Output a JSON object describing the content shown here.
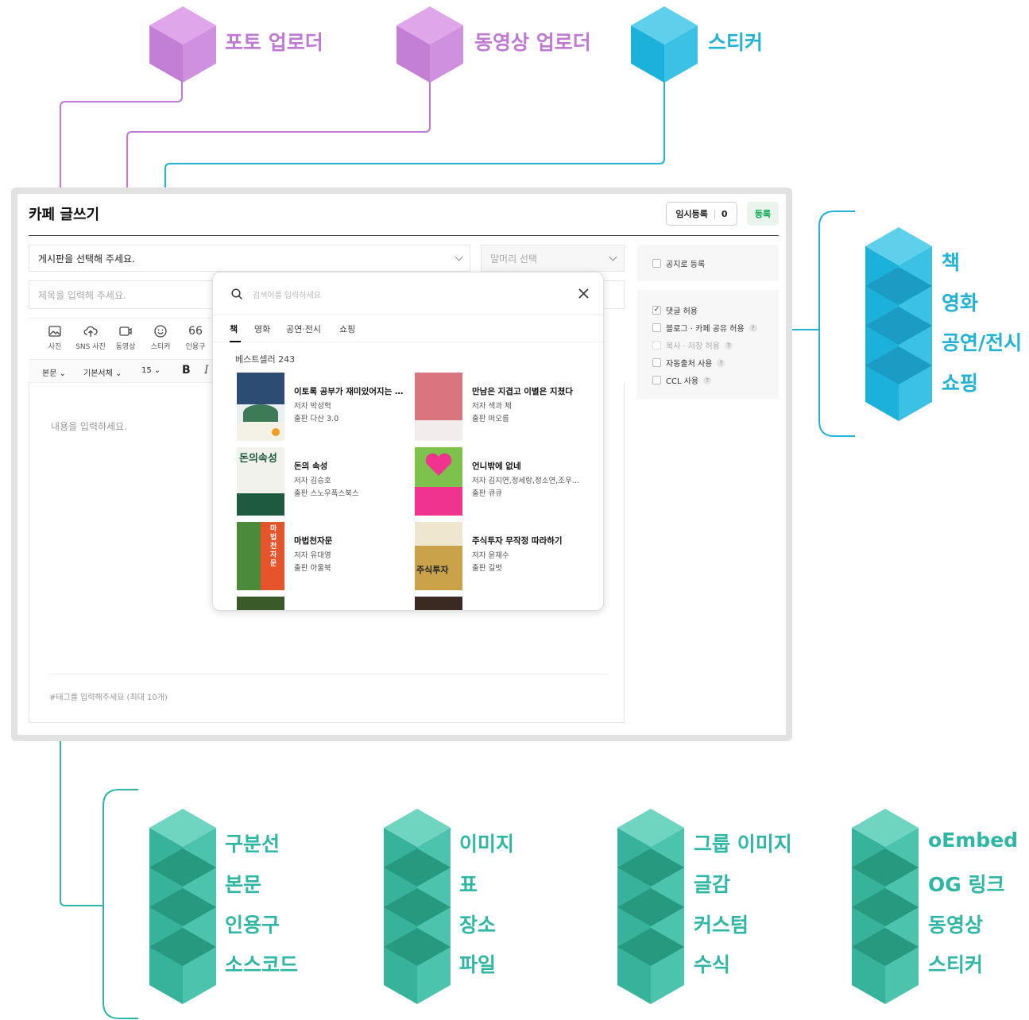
{
  "colors": {
    "purple": "#c07ad4",
    "cyan": "#22b2d6",
    "teal": "#2fb7a4",
    "accent_green": "#03a94d"
  },
  "top_labels": {
    "photo_uploader": "포토 업로더",
    "video_uploader": "동영상 업로더",
    "sticker": "스티커"
  },
  "categories": [
    "책",
    "영화",
    "공연/전시",
    "쇼핑"
  ],
  "component_groups": [
    [
      "구분선",
      "본문",
      "인용구",
      "소스코드"
    ],
    [
      "이미지",
      "표",
      "장소",
      "파일"
    ],
    [
      "그룹 이미지",
      "글감",
      "커스텀",
      "수식"
    ],
    [
      "oEmbed",
      "OG 링크",
      "동영상",
      "스티커"
    ]
  ],
  "editor": {
    "title": "카페 글쓰기",
    "temp_save_label": "임시등록",
    "temp_save_count": "0",
    "register_label": "등록",
    "board_select": "게시판을 선택해 주세요.",
    "prefix_select": "말머리 선택",
    "title_placeholder": "제목을 입력해 주세요.",
    "toolbar": {
      "photo": "사진",
      "sns_photo": "SNS 사진",
      "video": "동영상",
      "sticker": "스티커",
      "quote": "인용구",
      "quote_glyph": "66"
    },
    "format": {
      "paragraph": "본문",
      "font": "기본서체",
      "size": "15",
      "bold": "B",
      "italic": "I"
    },
    "content_placeholder": "내용을 입력하세요.",
    "tag_placeholder": "#태그를 입력해주세요 (최대 10개)"
  },
  "sidebar": {
    "notice": "공지로 등록",
    "options": [
      {
        "label": "댓글 허용",
        "checked": true,
        "disabled": false,
        "help": false
      },
      {
        "label": "블로그 · 카페 공유 허용",
        "checked": false,
        "disabled": false,
        "help": true
      },
      {
        "label": "복사 · 저장 허용",
        "checked": false,
        "disabled": true,
        "help": true
      },
      {
        "label": "자동출처 사용",
        "checked": false,
        "disabled": false,
        "help": true
      },
      {
        "label": "CCL 사용",
        "checked": false,
        "disabled": false,
        "help": true
      }
    ]
  },
  "popup": {
    "search_placeholder": "검색어를 입력하세요",
    "tabs": [
      "책",
      "영화",
      "공연·전시",
      "쇼핑"
    ],
    "section": "베스트셀러 243",
    "books": [
      {
        "title": "이토록 공부가 재미있어지는 …",
        "author": "저자  박성혁",
        "publisher": "출판  다산 3.0"
      },
      {
        "title": "만남은 지겹고 이별은 지쳤다",
        "author": "저자  색과 체",
        "publisher": "출판  떠오름"
      },
      {
        "title": "돈의 속성",
        "author": "저자  김승호",
        "publisher": "출판  스노우폭스북스"
      },
      {
        "title": "언니밖에 없네",
        "author": "저자  김지연,정세랑,정소연,조우…",
        "publisher": "출판  큐큐"
      },
      {
        "title": "마법천자문",
        "author": "저자  유대영",
        "publisher": "출판  아울북"
      },
      {
        "title": "주식투자 무작정 따라하기",
        "author": "저자  윤재수",
        "publisher": "출판  길벗"
      }
    ],
    "cover_text": {
      "money": "돈의속성",
      "magic": "마법천자문",
      "stock": "주식투자"
    }
  }
}
